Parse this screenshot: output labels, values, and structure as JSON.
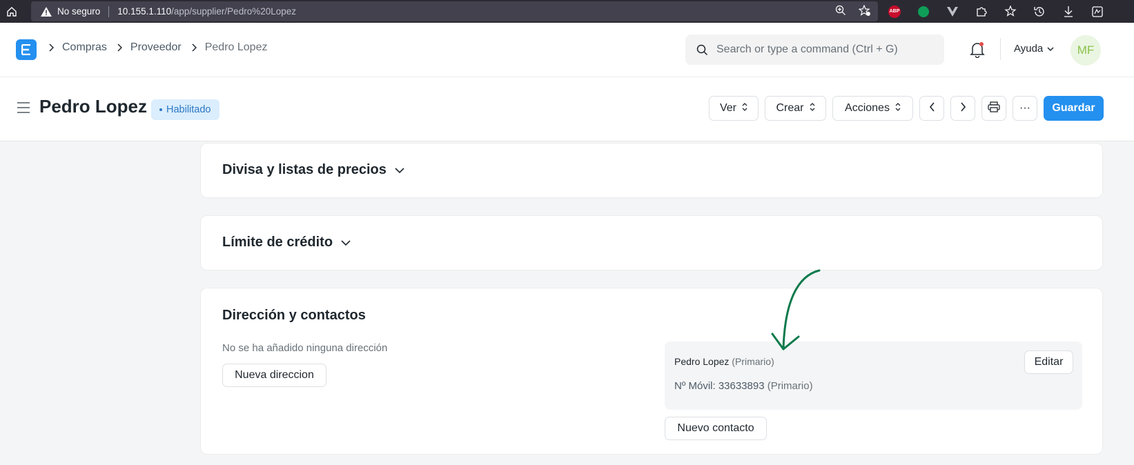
{
  "browser": {
    "insecure_label": "No seguro",
    "url_host": "10.155.1.110",
    "url_path": "/app/supplier/Pedro%20Lopez",
    "abp_label": "ABP"
  },
  "navbar": {
    "logo_letter": "E",
    "breadcrumb": [
      "Compras",
      "Proveedor",
      "Pedro Lopez"
    ],
    "search_placeholder": "Search or type a command (Ctrl + G)",
    "help_label": "Ayuda",
    "avatar_initials": "MF"
  },
  "page": {
    "title": "Pedro Lopez",
    "status": "Habilitado",
    "buttons": {
      "view": "Ver",
      "create": "Crear",
      "actions": "Acciones",
      "more": "···",
      "save": "Guardar"
    }
  },
  "sections": {
    "currency": "Divisa y listas de precios",
    "credit": "Límite de crédito",
    "address_contacts": "Dirección y contactos"
  },
  "address": {
    "empty_text": "No se ha añadido ninguna dirección",
    "new_address": "Nueva direccion"
  },
  "contact": {
    "name": "Pedro Lopez",
    "name_tag": "(Primario)",
    "phone_label": "Nº Móvil: 33633893",
    "phone_tag": "(Primario)",
    "edit": "Editar",
    "new_contact": "Nuevo contacto"
  },
  "colors": {
    "primary": "#2490ef",
    "annotation_arrow": "#0b7a4b",
    "status_bg": "#dbeefe"
  }
}
